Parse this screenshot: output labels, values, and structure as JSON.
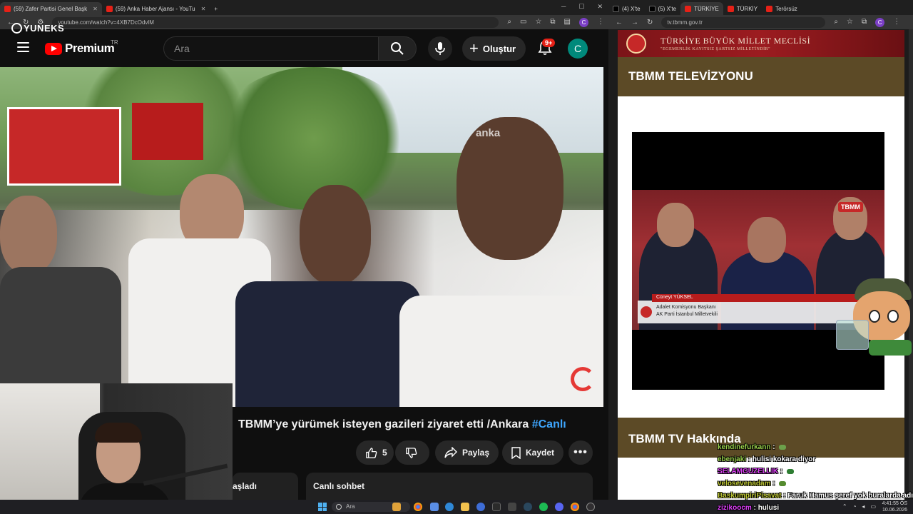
{
  "left_browser": {
    "tabs": [
      {
        "title": "(59) Zafer Partisi Genel Başk",
        "active": true
      },
      {
        "title": "(59) Anka Haber Ajansı - YouTu",
        "active": false
      }
    ],
    "url": "youtube.com/watch?v=4XB7DcOdvlM",
    "profile_initial": "C"
  },
  "overlay": {
    "channel_watermark": "YUNEKS"
  },
  "youtube": {
    "brand": "Premium",
    "region": "TR",
    "search_placeholder": "Ara",
    "create_label": "Oluştur",
    "notification_count": "9+",
    "avatar_initial": "C",
    "video_watermark": "anka",
    "video_title": "TBMM’ye yürümek isteyen gazileri ziyaret etti /Ankara",
    "video_hashtag": "#Canlı",
    "like_count": "5",
    "share_label": "Paylaş",
    "save_label": "Kaydet",
    "started_label_partial": "aşladı",
    "live_chat_label": "Canlı sohbet"
  },
  "right_browser": {
    "tabs": [
      {
        "title": "(4) X'te"
      },
      {
        "title": "(5) X'te"
      },
      {
        "title": "TÜRKİYE"
      },
      {
        "title": "TÜRKİY"
      },
      {
        "title": "Terörsüz"
      }
    ],
    "url": "tv.tbmm.gov.tr",
    "profile_initial": "C"
  },
  "tbmm": {
    "site_name": "TÜRKİYE BÜYÜK MİLLET MECLİSİ",
    "site_motto": "\"EGEMENLİK KAYITSIZ ŞARTSIZ MİLLETİNDİR\"",
    "page_title": "TBMM TELEVİZYONU",
    "stream_logo": "TBMM",
    "speaker_name": "Cüneyt YÜKSEL",
    "speaker_role": "Adalet Komisyonu Başkanı",
    "speaker_party": "AK Parti İstanbul Milletvekili",
    "about_title": "TBMM TV Hakkında"
  },
  "chat": [
    {
      "user": "kendinefurkann",
      "color": "#9ad14b",
      "message": ""
    },
    {
      "user": "ebenjaki",
      "color": "#9ad14b",
      "message": "hulisi kokara diyor"
    },
    {
      "user": "SELAMGUZELLIK",
      "color": "#e040fb",
      "message": ""
    },
    {
      "user": "velosevenadam",
      "color": "#c0ca33",
      "message": ""
    },
    {
      "user": "BaskumpiriPisavat",
      "color": "#c0ca33",
      "message": "Faruk Hamus şeref yok buralarda adım"
    },
    {
      "user": "zizikoocm",
      "color": "#e040fb",
      "message": "hulusi"
    }
  ],
  "taskbar": {
    "search_placeholder": "Ara",
    "time": "4:41:55 ÖS",
    "date": "10.06.2026"
  }
}
